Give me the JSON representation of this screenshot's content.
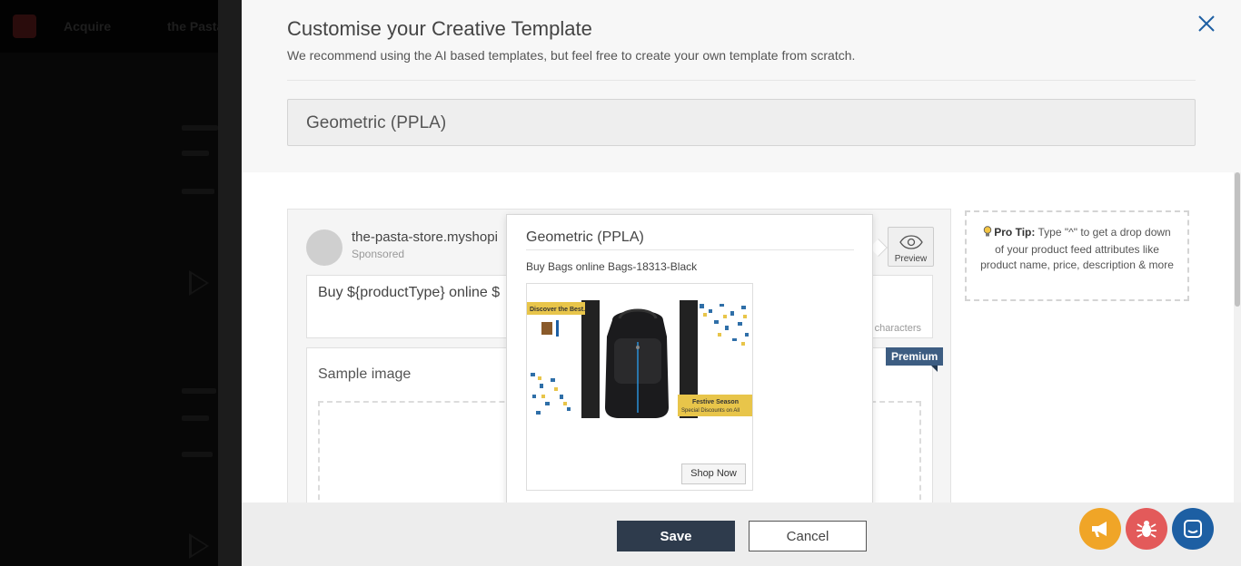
{
  "background": {
    "nav": [
      "Acquire",
      "the Pasta"
    ]
  },
  "drawer": {
    "title": "Customise your Creative Template",
    "subtitle": "We recommend using the AI based templates, but feel free to create your own template from scratch.",
    "selected_template": "Geometric (PPLA)",
    "close_icon": "close-icon"
  },
  "ad": {
    "page_name": "the-pasta-store.myshopi",
    "sponsored": "Sponsored",
    "primary_text": "Buy ${productType} online $",
    "char_count": "characters",
    "sample_image_label": "Sample image",
    "premium_badge": "Premium",
    "preview_label": "Preview",
    "preview_icon": "eye-icon"
  },
  "pro_tip": {
    "label": "Pro Tip:",
    "text": " Type \"^\" to get a drop down of your product feed attributes like product name, price, description & more",
    "icon": "lightbulb-icon"
  },
  "popover": {
    "title": "Geometric (PPLA)",
    "subtitle": "Buy Bags online Bags-18313-Black",
    "creative": {
      "top_banner": "Discover the Best.",
      "bottom_banner_line1": "Festive Season",
      "bottom_banner_line2": "Special Discounts on All"
    },
    "cta": "Shop Now"
  },
  "footer": {
    "save_label": "Save",
    "cancel_label": "Cancel"
  },
  "fabs": [
    {
      "name": "announcement-button",
      "icon": "megaphone-icon",
      "color": "#f0a527"
    },
    {
      "name": "report-bug-button",
      "icon": "bug-icon",
      "color": "#e35a5a"
    },
    {
      "name": "chat-button",
      "icon": "chat-icon",
      "color": "#1d5fa3"
    }
  ],
  "colors": {
    "accent": "#2e3b4c",
    "premium": "#3d5d82",
    "link": "#1d5fa3"
  }
}
